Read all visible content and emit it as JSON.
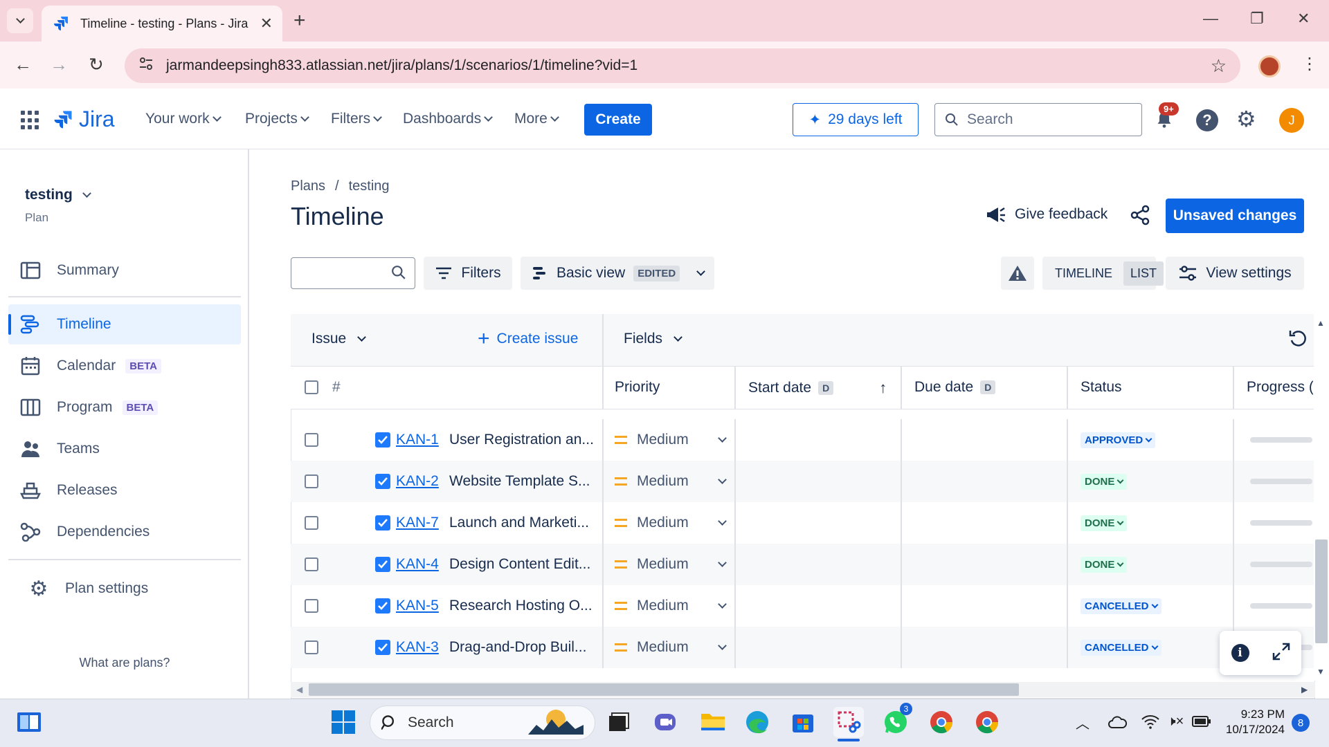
{
  "browser": {
    "tab_title": "Timeline - testing - Plans - Jira",
    "url": "jarmandeepsingh833.atlassian.net/jira/plans/1/scenarios/1/timeline?vid=1"
  },
  "topnav": {
    "product": "Jira",
    "items": [
      "Your work",
      "Projects",
      "Filters",
      "Dashboards",
      "More"
    ],
    "create_label": "Create",
    "trial_label": "29 days left",
    "search_placeholder": "Search",
    "notification_badge": "9+",
    "user_initial": "J"
  },
  "sidebar": {
    "plan_name": "testing",
    "plan_sub": "Plan",
    "items": [
      {
        "label": "Summary",
        "icon": "summary-icon"
      },
      {
        "label": "Timeline",
        "icon": "timeline-icon",
        "active": true
      },
      {
        "label": "Calendar",
        "icon": "calendar-icon",
        "badge": "BETA"
      },
      {
        "label": "Program",
        "icon": "program-icon",
        "badge": "BETA"
      },
      {
        "label": "Teams",
        "icon": "teams-icon"
      },
      {
        "label": "Releases",
        "icon": "releases-icon"
      },
      {
        "label": "Dependencies",
        "icon": "dependencies-icon"
      }
    ],
    "settings_label": "Plan settings",
    "footer_link": "What are plans?"
  },
  "main": {
    "breadcrumb": [
      "Plans",
      "/",
      "testing"
    ],
    "title": "Timeline",
    "feedback_label": "Give feedback",
    "unsaved_label": "Unsaved changes",
    "filters_label": "Filters",
    "view_label": "Basic view",
    "view_badge": "EDITED",
    "seg_timeline": "TIMELINE",
    "seg_list": "LIST",
    "view_settings_label": "View settings"
  },
  "table": {
    "issue_header": "Issue",
    "create_issue_label": "Create issue",
    "fields_label": "Fields",
    "hash": "#",
    "columns": {
      "priority": "Priority",
      "start_date": "Start date",
      "due_date": "Due date",
      "date_badge": "D",
      "status": "Status",
      "progress": "Progress (i"
    },
    "rows": [
      {
        "key": "KAN-1",
        "summary": "User Registration an...",
        "priority": "Medium",
        "status": "APPROVED",
        "status_color": "#0055cc"
      },
      {
        "key": "KAN-2",
        "summary": "Website Template S...",
        "priority": "Medium",
        "status": "DONE",
        "status_color": "#216e4e"
      },
      {
        "key": "KAN-7",
        "summary": "Launch and Marketi...",
        "priority": "Medium",
        "status": "DONE",
        "status_color": "#216e4e"
      },
      {
        "key": "KAN-4",
        "summary": "Design Content Edit...",
        "priority": "Medium",
        "status": "DONE",
        "status_color": "#216e4e"
      },
      {
        "key": "KAN-5",
        "summary": "Research Hosting O...",
        "priority": "Medium",
        "status": "CANCELLED",
        "status_color": "#0055cc"
      },
      {
        "key": "KAN-3",
        "summary": "Drag-and-Drop Buil...",
        "priority": "Medium",
        "status": "CANCELLED",
        "status_color": "#0055cc"
      }
    ]
  },
  "taskbar": {
    "search_placeholder": "Search",
    "time": "9:23 PM",
    "date": "10/17/2024",
    "notification_count": "8",
    "whatsapp_badge": "3"
  },
  "colors": {
    "brand": "#0c66e4",
    "tabbar": "#f6d5dc"
  }
}
